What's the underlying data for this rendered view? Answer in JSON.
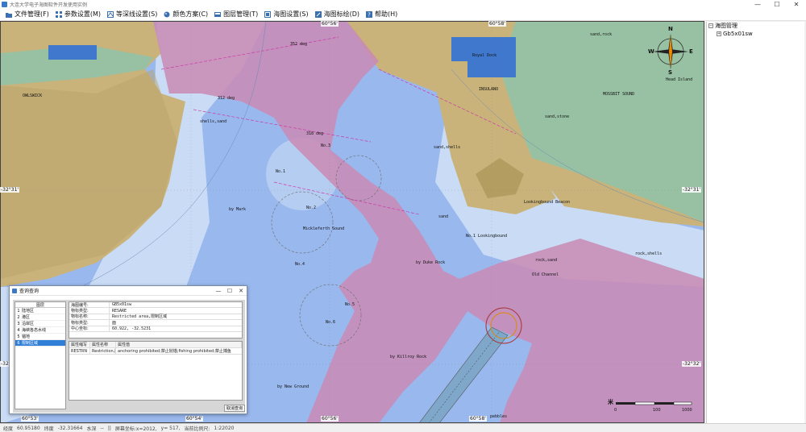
{
  "window": {
    "title": "大连大学电子海图软件开发使用实例",
    "controls": [
      "—",
      "☐",
      "✕"
    ]
  },
  "menu": [
    {
      "label": "文件管理(F)",
      "icon": "folder-icon"
    },
    {
      "label": "参数设置(M)",
      "icon": "grid-icon"
    },
    {
      "label": "等深线设置(S)",
      "icon": "contour-icon"
    },
    {
      "label": "颜色方案(C)",
      "icon": "palette-icon"
    },
    {
      "label": "图层管理(T)",
      "icon": "layers-icon"
    },
    {
      "label": "海图设置(S)",
      "icon": "chart-settings-icon"
    },
    {
      "label": "海图标绘(D)",
      "icon": "plotting-icon"
    },
    {
      "label": "帮助(H)",
      "icon": "help-icon"
    }
  ],
  "chart": {
    "colors": {
      "deep_water": "#99b8ee",
      "shallow_water": "#c9dbf5",
      "land": "#c9b37a",
      "land_dark": "#b9a46c",
      "intertidal": "#97c1a2",
      "restricted": "#c98ab4",
      "dock": "#3f78cc"
    },
    "coord_labels": {
      "top": [
        "60°54'",
        "60°56'",
        "60°58'"
      ],
      "bottom": [
        "60°53'",
        "60°54'",
        "60°56'",
        "60°58'"
      ],
      "left": [
        "-32°31'",
        "-32°32'"
      ],
      "right": [
        "-32°31'",
        "-32°32'"
      ]
    },
    "place_labels": [
      "OWLSWICK",
      "Royal Dock",
      "INSULANO",
      "MOSSBIT SOUND",
      "Head Island",
      "Mickleferth Sound",
      "Old Channel",
      "No.1 Lookingbound",
      "Lookingbound Beacon",
      "shells,sand",
      "sand,shells",
      "sand,stone",
      "sand,rock",
      "rock,sand",
      "rock,shells",
      "by Mark",
      "by Duke Rock",
      "by Killroy Rock",
      "by New Ground",
      "312 deg",
      "318 deg",
      "352 deg",
      "No.1",
      "No.2",
      "No.3",
      "No.4",
      "No.5",
      "No.6",
      "pebbles",
      "sand"
    ],
    "scale": {
      "start": "0",
      "mid": "100",
      "end": "1000",
      "unit": "米"
    }
  },
  "tree": {
    "root": "海图管理",
    "child": "Gb5x01sw"
  },
  "status": {
    "text": [
      "经度",
      "60.95180",
      "纬度",
      "-32.31664",
      "水深",
      "--",
      "||",
      "屏幕坐标:x=2012,",
      "y= 517,",
      "当前比例尺:",
      "1:22020"
    ]
  },
  "dialog": {
    "title": "查询查询",
    "layer_header": "图层",
    "layers": [
      {
        "idx": "1",
        "name": "陆地区"
      },
      {
        "idx": "2",
        "name": "港区"
      },
      {
        "idx": "3",
        "name": "沿岸区"
      },
      {
        "idx": "4",
        "name": "海峡各态水线"
      },
      {
        "idx": "5",
        "name": "锚地"
      },
      {
        "idx": "6",
        "name": "限制区域"
      }
    ],
    "selected_index": 5,
    "properties": [
      {
        "k": "海图编号:",
        "v": "GB5x01sw"
      },
      {
        "k": "物标类型:",
        "v": "RESARE"
      },
      {
        "k": "物标名称:",
        "v": "Restricted area,限制区域"
      },
      {
        "k": "物标类型:",
        "v": "面"
      },
      {
        "k": "中心坐标:",
        "v": "60.922, -32.5231"
      }
    ],
    "attr_headers": [
      "属性缩写",
      "属性名称",
      "属性值"
    ],
    "attr_rows": [
      {
        "abbr": "RESTRN",
        "name": "Restriction,限制区",
        "value": "anchoring prohibited;禁止抛锚;fishing prohibited;禁止捕鱼"
      }
    ],
    "cancel": "取消查询"
  }
}
